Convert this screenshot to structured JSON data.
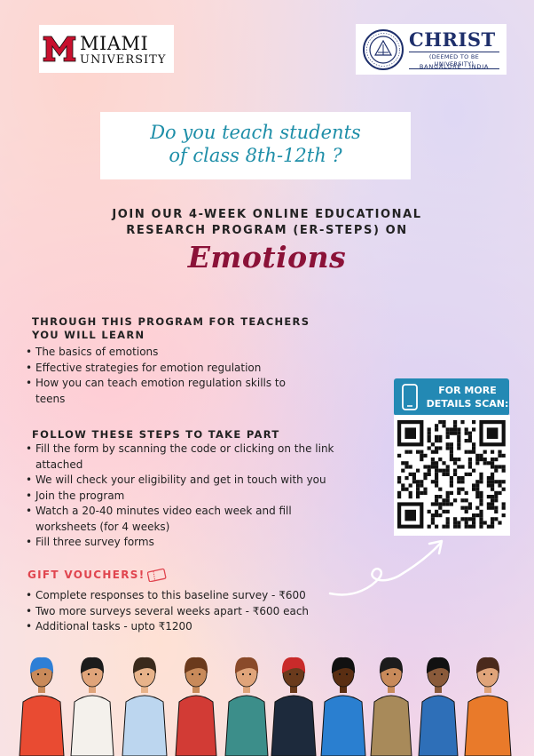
{
  "logos": {
    "miami": {
      "line1": "MIAMI",
      "line2": "UNIVERSITY"
    },
    "christ": {
      "name": "CHRIST",
      "sub": "(DEEMED TO BE UNIVERSITY)",
      "place": "BANGALORE · INDIA"
    }
  },
  "question": {
    "line1": "Do you teach students",
    "line2": "of class 8th-12th ?"
  },
  "join": {
    "line1": "JOIN OUR 4-WEEK ONLINE EDUCATIONAL",
    "line2": "RESEARCH PROGRAM (ER-STEPS) ON"
  },
  "topic": "Emotions",
  "learn": {
    "heading1": "THROUGH THIS PROGRAM FOR TEACHERS",
    "heading2": "YOU WILL LEARN",
    "items": [
      "The basics of emotions",
      "Effective strategies for emotion regulation",
      "How you can teach emotion regulation skills to teens"
    ]
  },
  "steps": {
    "heading": "FOLLOW THESE STEPS TO TAKE PART",
    "items": [
      "Fill the form by scanning the code or clicking on the link attached",
      "We will check your eligibility and get in touch with you",
      "Join the program",
      "Watch a 20-40 minutes video each week and fill worksheets (for 4 weeks)",
      "Fill three survey forms"
    ]
  },
  "gifts": {
    "heading": "GIFT VOUCHERS!",
    "items": [
      "Complete responses to this baseline survey - ₹600",
      "Two more surveys several weeks apart - ₹600 each",
      "Additional tasks - upto ₹1200"
    ]
  },
  "scan": {
    "line1": "FOR MORE",
    "line2": "DETAILS SCAN:"
  },
  "colors": {
    "accent_teal": "#1d8ea8",
    "emotions_maroon": "#8b1238",
    "gift_red": "#e0454f",
    "scan_blue": "#2389b4"
  },
  "icons": [
    "miami-m-logo",
    "christ-seal-logo",
    "ticket-icon",
    "phone-icon",
    "qr-code",
    "curved-arrow",
    "people-illustration"
  ]
}
